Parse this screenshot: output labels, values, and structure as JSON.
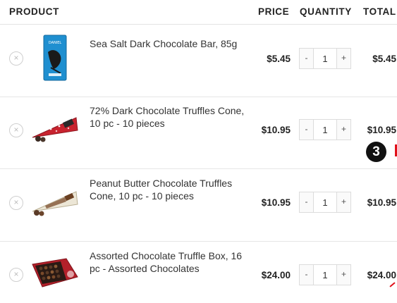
{
  "table": {
    "headers": {
      "product": "PRODUCT",
      "price": "PRICE",
      "quantity": "QUANTITY",
      "total": "TOTAL"
    },
    "remove_glyph": "×",
    "items": [
      {
        "name": "Sea Salt Dark Chocolate Bar, 85g",
        "price": "$5.45",
        "minus": "-",
        "quantity": "1",
        "plus": "+",
        "total": "$5.45"
      },
      {
        "name": "72% Dark Chocolate Truffles Cone, 10 pc - 10 pieces",
        "price": "$10.95",
        "minus": "-",
        "quantity": "1",
        "plus": "+",
        "total": "$10.95"
      },
      {
        "name": "Peanut Butter Chocolate Truffles Cone, 10 pc - 10 pieces",
        "price": "$10.95",
        "minus": "-",
        "quantity": "1",
        "plus": "+",
        "total": "$10.95"
      },
      {
        "name": "Assorted Chocolate Truffle Box, 16 pc - Assorted Chocolates",
        "price": "$24.00",
        "minus": "-",
        "quantity": "1",
        "plus": "+",
        "total": "$24.00"
      }
    ]
  },
  "annotation": {
    "badge": "3",
    "badge_color": "#111111",
    "marker_color": "#e0101a"
  }
}
